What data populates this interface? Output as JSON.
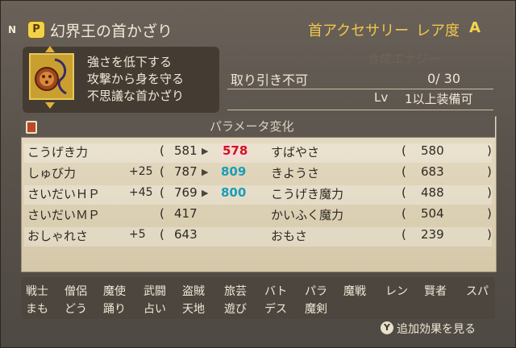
{
  "header": {
    "n_badge": "N",
    "p_badge": "P",
    "item_name": "幻界王の首かざり",
    "item_type": "首アクセサリー",
    "rarity_label": "レア度",
    "rarity_value": "A"
  },
  "description": [
    "強さを低下する",
    "攻撃から身を守る",
    "不思議な首かざり"
  ],
  "info": {
    "no_trade": "取り引き不可",
    "synth_label": "合成エナジー",
    "synth_value": "0/ 30",
    "lv_label": "Lv",
    "lv_value": "1以上装備可"
  },
  "params": {
    "title": "パラメータ変化",
    "left": [
      {
        "name": "こうげき力",
        "bonus": "",
        "open": "(",
        "value": "581",
        "arrow": "▶",
        "new": "578",
        "new_color": "red"
      },
      {
        "name": "しゅび力",
        "bonus": "+25",
        "open": "(",
        "value": "787",
        "arrow": "▶",
        "new": "809",
        "new_color": "cyan"
      },
      {
        "name": "さいだいＨＰ",
        "bonus": "+45",
        "open": "(",
        "value": "769",
        "arrow": "▶",
        "new": "800",
        "new_color": "cyan"
      },
      {
        "name": "さいだいＭＰ",
        "bonus": "",
        "open": "(",
        "value": "417",
        "arrow": "",
        "new": "",
        "new_color": ""
      },
      {
        "name": "おしゃれさ",
        "bonus": "+5",
        "open": "(",
        "value": "643",
        "arrow": "",
        "new": "",
        "new_color": ""
      }
    ],
    "right": [
      {
        "name": "すばやさ",
        "open": "(",
        "value": "580",
        "close": ")"
      },
      {
        "name": "きようさ",
        "open": "(",
        "value": "683",
        "close": ")"
      },
      {
        "name": "こうげき魔力",
        "open": "(",
        "value": "488",
        "close": ")"
      },
      {
        "name": "かいふく魔力",
        "open": "(",
        "value": "504",
        "close": ")"
      },
      {
        "name": "おもさ",
        "open": "(",
        "value": "239",
        "close": ")"
      }
    ]
  },
  "jobs": {
    "row1": [
      "戦士",
      "僧侶",
      "魔使",
      "武闘",
      "盗賊",
      "旅芸",
      "バト",
      "パラ",
      "魔戦",
      "レン",
      "賢者",
      "スパ"
    ],
    "row2": [
      "まも",
      "どう",
      "踊り",
      "占い",
      "天地",
      "遊び",
      "デス",
      "魔剣"
    ]
  },
  "footer": {
    "button": "Y",
    "extra_label": "追加効果を見る"
  },
  "colors": {
    "accent_gold": "#f0c64a",
    "decrease_red": "#c8181e",
    "increase_cyan": "#1a9db8"
  }
}
